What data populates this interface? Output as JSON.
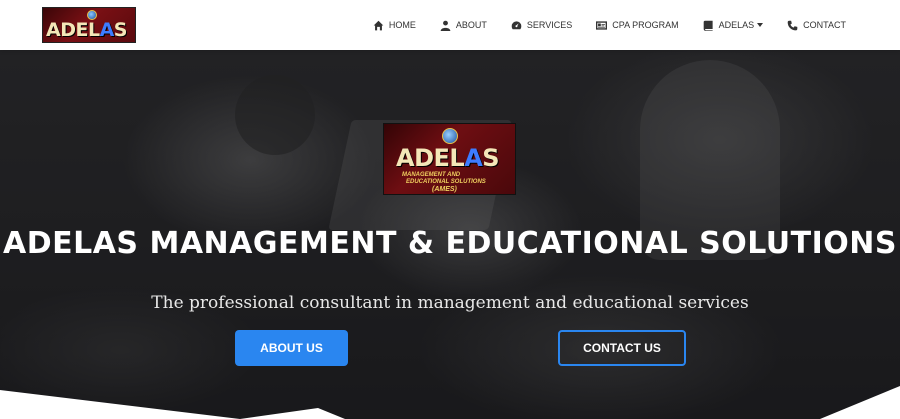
{
  "logo": {
    "text_main": "ADEL",
    "text_accent": "A",
    "text_end": "S"
  },
  "hero_logo": {
    "text_main": "ADEL",
    "text_accent": "A",
    "text_end": "S",
    "line1": "MANAGEMENT AND",
    "line2": "EDUCATIONAL SOLUTIONS",
    "line3": "(AMES)"
  },
  "nav": {
    "items": [
      {
        "label": "HOME",
        "icon": "home-icon"
      },
      {
        "label": "ABOUT",
        "icon": "user-icon"
      },
      {
        "label": "SERVICES",
        "icon": "gauge-icon"
      },
      {
        "label": "CPA PROGRAM",
        "icon": "id-card-icon"
      },
      {
        "label": "ADELAS",
        "icon": "book-icon"
      },
      {
        "label": "CONTACT",
        "icon": "phone-icon"
      }
    ]
  },
  "hero": {
    "title": "ADELAS MANAGEMENT & EDUCATIONAL SOLUTIONS",
    "subtitle": "The professional consultant in management and educational services",
    "buttons": {
      "about": "ABOUT US",
      "contact": "CONTACT US"
    }
  },
  "colors": {
    "accent": "#2a86f0",
    "logo_bg": "#6e0e12",
    "logo_text": "#f4e7b8"
  }
}
